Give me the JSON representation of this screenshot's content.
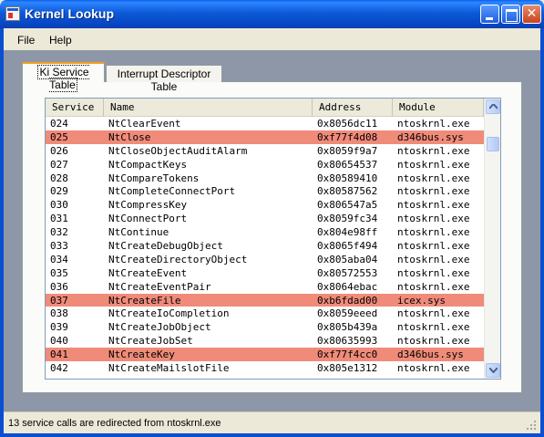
{
  "window": {
    "title": "Kernel Lookup"
  },
  "menu": {
    "file": "File",
    "help": "Help"
  },
  "tabs": [
    {
      "label": "Ki Service Table"
    },
    {
      "label": "Interrupt Descriptor Table"
    }
  ],
  "columns": [
    "Service",
    "Name",
    "Address",
    "Module"
  ],
  "rows": [
    {
      "service": "024",
      "name": "NtClearEvent",
      "address": "0x8056dc11",
      "module": "ntoskrnl.exe",
      "highlight": false
    },
    {
      "service": "025",
      "name": "NtClose",
      "address": "0xf77f4d08",
      "module": "d346bus.sys",
      "highlight": true
    },
    {
      "service": "026",
      "name": "NtCloseObjectAuditAlarm",
      "address": "0x8059f9a7",
      "module": "ntoskrnl.exe",
      "highlight": false
    },
    {
      "service": "027",
      "name": "NtCompactKeys",
      "address": "0x80654537",
      "module": "ntoskrnl.exe",
      "highlight": false
    },
    {
      "service": "028",
      "name": "NtCompareTokens",
      "address": "0x80589410",
      "module": "ntoskrnl.exe",
      "highlight": false
    },
    {
      "service": "029",
      "name": "NtCompleteConnectPort",
      "address": "0x80587562",
      "module": "ntoskrnl.exe",
      "highlight": false
    },
    {
      "service": "030",
      "name": "NtCompressKey",
      "address": "0x806547a5",
      "module": "ntoskrnl.exe",
      "highlight": false
    },
    {
      "service": "031",
      "name": "NtConnectPort",
      "address": "0x8059fc34",
      "module": "ntoskrnl.exe",
      "highlight": false
    },
    {
      "service": "032",
      "name": "NtContinue",
      "address": "0x804e98ff",
      "module": "ntoskrnl.exe",
      "highlight": false
    },
    {
      "service": "033",
      "name": "NtCreateDebugObject",
      "address": "0x8065f494",
      "module": "ntoskrnl.exe",
      "highlight": false
    },
    {
      "service": "034",
      "name": "NtCreateDirectoryObject",
      "address": "0x805aba04",
      "module": "ntoskrnl.exe",
      "highlight": false
    },
    {
      "service": "035",
      "name": "NtCreateEvent",
      "address": "0x80572553",
      "module": "ntoskrnl.exe",
      "highlight": false
    },
    {
      "service": "036",
      "name": "NtCreateEventPair",
      "address": "0x8064ebac",
      "module": "ntoskrnl.exe",
      "highlight": false
    },
    {
      "service": "037",
      "name": "NtCreateFile",
      "address": "0xb6fdad00",
      "module": "icex.sys",
      "highlight": true
    },
    {
      "service": "038",
      "name": "NtCreateIoCompletion",
      "address": "0x8059eeed",
      "module": "ntoskrnl.exe",
      "highlight": false
    },
    {
      "service": "039",
      "name": "NtCreateJobObject",
      "address": "0x805b439a",
      "module": "ntoskrnl.exe",
      "highlight": false
    },
    {
      "service": "040",
      "name": "NtCreateJobSet",
      "address": "0x80635993",
      "module": "ntoskrnl.exe",
      "highlight": false
    },
    {
      "service": "041",
      "name": "NtCreateKey",
      "address": "0xf77f4cc0",
      "module": "d346bus.sys",
      "highlight": true
    },
    {
      "service": "042",
      "name": "NtCreateMailslotFile",
      "address": "0x805e1312",
      "module": "ntoskrnl.exe",
      "highlight": false
    }
  ],
  "status": {
    "text": "13 service calls are redirected from ntoskrnl.exe"
  },
  "colors": {
    "highlight": "#f08b7a",
    "titlebar": "#0b5ad8",
    "client": "#8d97a8"
  },
  "icons": [
    "app-icon",
    "minimize-icon",
    "maximize-icon",
    "close-icon",
    "scroll-up-arrow-icon",
    "scroll-down-arrow-icon",
    "size-grip-icon"
  ]
}
